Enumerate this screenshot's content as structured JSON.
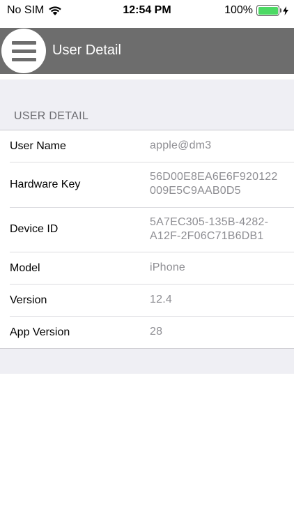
{
  "status_bar": {
    "carrier": "No SIM",
    "time": "12:54 PM",
    "battery_percent": "100%",
    "wifi_icon": "wifi-icon",
    "charging_icon": "bolt-icon",
    "battery_level": 1.0
  },
  "nav": {
    "menu_icon": "hamburger-menu-icon",
    "title": "User Detail"
  },
  "section": {
    "header": "USER DETAIL"
  },
  "rows": [
    {
      "label": "User Name",
      "value_lines": [
        "apple@dm3"
      ]
    },
    {
      "label": "Hardware Key",
      "value_lines": [
        "56D00E8EA6E6F920122",
        "009E5C9AAB0D5"
      ]
    },
    {
      "label": "Device ID",
      "value_lines": [
        "5A7EC305-135B-4282-",
        "A12F-2F06C71B6DB1"
      ]
    },
    {
      "label": "Model",
      "value_lines": [
        "iPhone"
      ]
    },
    {
      "label": "Version",
      "value_lines": [
        "12.4"
      ]
    },
    {
      "label": "App Version",
      "value_lines": [
        "28"
      ]
    }
  ],
  "colors": {
    "nav_bar": "#6d6d6d",
    "grouped_background": "#efeff4",
    "value_text": "#8e8e93",
    "battery_green": "#4cd964"
  }
}
